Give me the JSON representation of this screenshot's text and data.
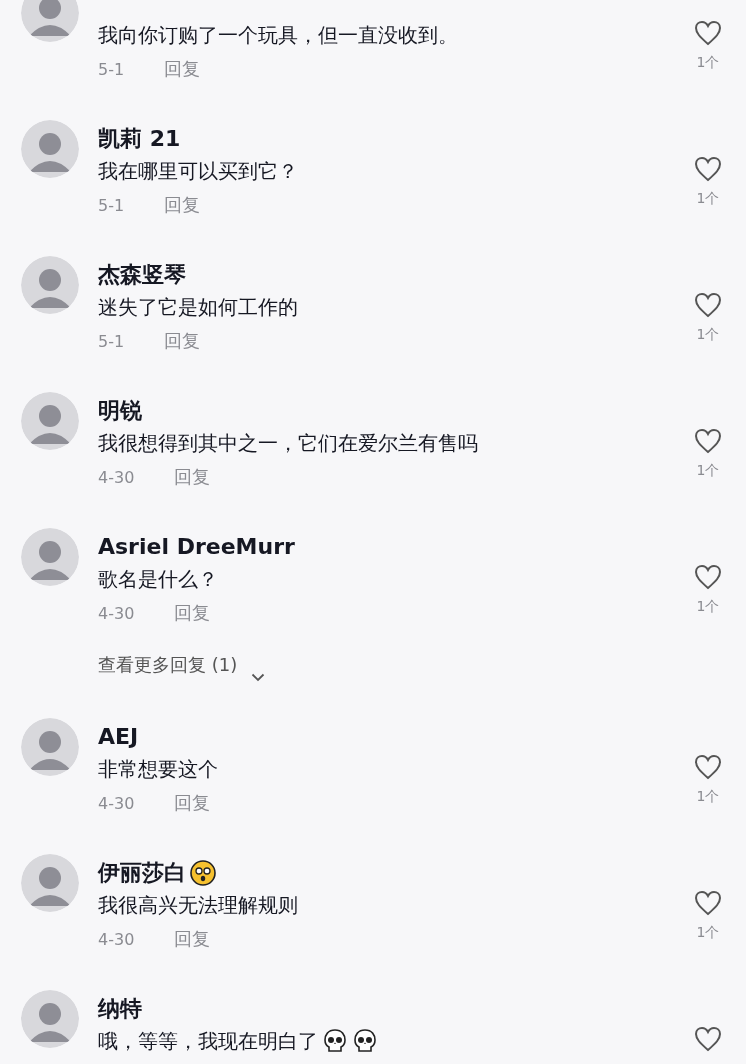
{
  "comments": [
    {
      "text": "我向你订购了一个玩具，但一直没收到。",
      "date": "5-1",
      "reply": "回复",
      "likes": "1个"
    },
    {
      "name": "凯莉 21",
      "text": "我在哪里可以买到它？",
      "date": "5-1",
      "reply": "回复",
      "likes": "1个"
    },
    {
      "name": "杰森竖琴",
      "text": "迷失了它是如何工作的",
      "date": "5-1",
      "reply": "回复",
      "likes": "1个"
    },
    {
      "name": "明锐",
      "text": "我很想得到其中之一，它们在爱尔兰有售吗",
      "date": "4-30",
      "reply": "回复",
      "likes": "1个"
    },
    {
      "name": "Asriel DreeMurr",
      "text": "歌名是什么？",
      "date": "4-30",
      "reply": "回复",
      "likes": "1个",
      "more_replies": "查看更多回复 (1)"
    },
    {
      "name": "AEJ",
      "text": "非常想要这个",
      "date": "4-30",
      "reply": "回复",
      "likes": "1个"
    },
    {
      "name": "伊丽莎白",
      "name_icons": [
        {
          "kind": "face"
        }
      ],
      "text": "我很高兴无法理解规则",
      "date": "4-30",
      "reply": "回复",
      "likes": "1个"
    },
    {
      "name": "纳特",
      "text": "哦，等等，我现在明白了",
      "text_icons": [
        {
          "kind": "skull"
        },
        {
          "kind": "skull"
        }
      ]
    }
  ]
}
